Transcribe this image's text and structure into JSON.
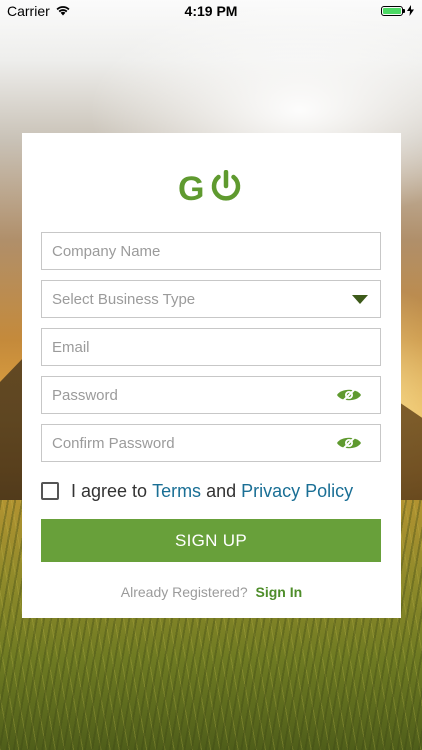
{
  "status_bar": {
    "carrier": "Carrier",
    "time": "4:19 PM",
    "battery_level": 1.0
  },
  "brand": {
    "logo_letter": "G",
    "logo_color": "#5f9a2f"
  },
  "form": {
    "company_name_placeholder": "Company Name",
    "business_type_placeholder": "Select Business Type",
    "email_placeholder": "Email",
    "password_placeholder": "Password",
    "confirm_password_placeholder": "Confirm Password",
    "agree_prefix": "I agree to",
    "terms_link": "Terms",
    "and_text": "and",
    "privacy_link": "Privacy Policy",
    "signup_label": "SIGN UP",
    "already_registered": "Already Registered?",
    "signin_link": "Sign In"
  },
  "colors": {
    "accent": "#68a03a",
    "link": "#1a6f95",
    "signin": "#4e8d2a"
  },
  "icons": {
    "wifi": "wifi-icon",
    "battery": "battery-icon",
    "charging": "charging-icon",
    "eye": "eye-slash-icon",
    "caret": "caret-down-icon",
    "power": "power-icon"
  }
}
